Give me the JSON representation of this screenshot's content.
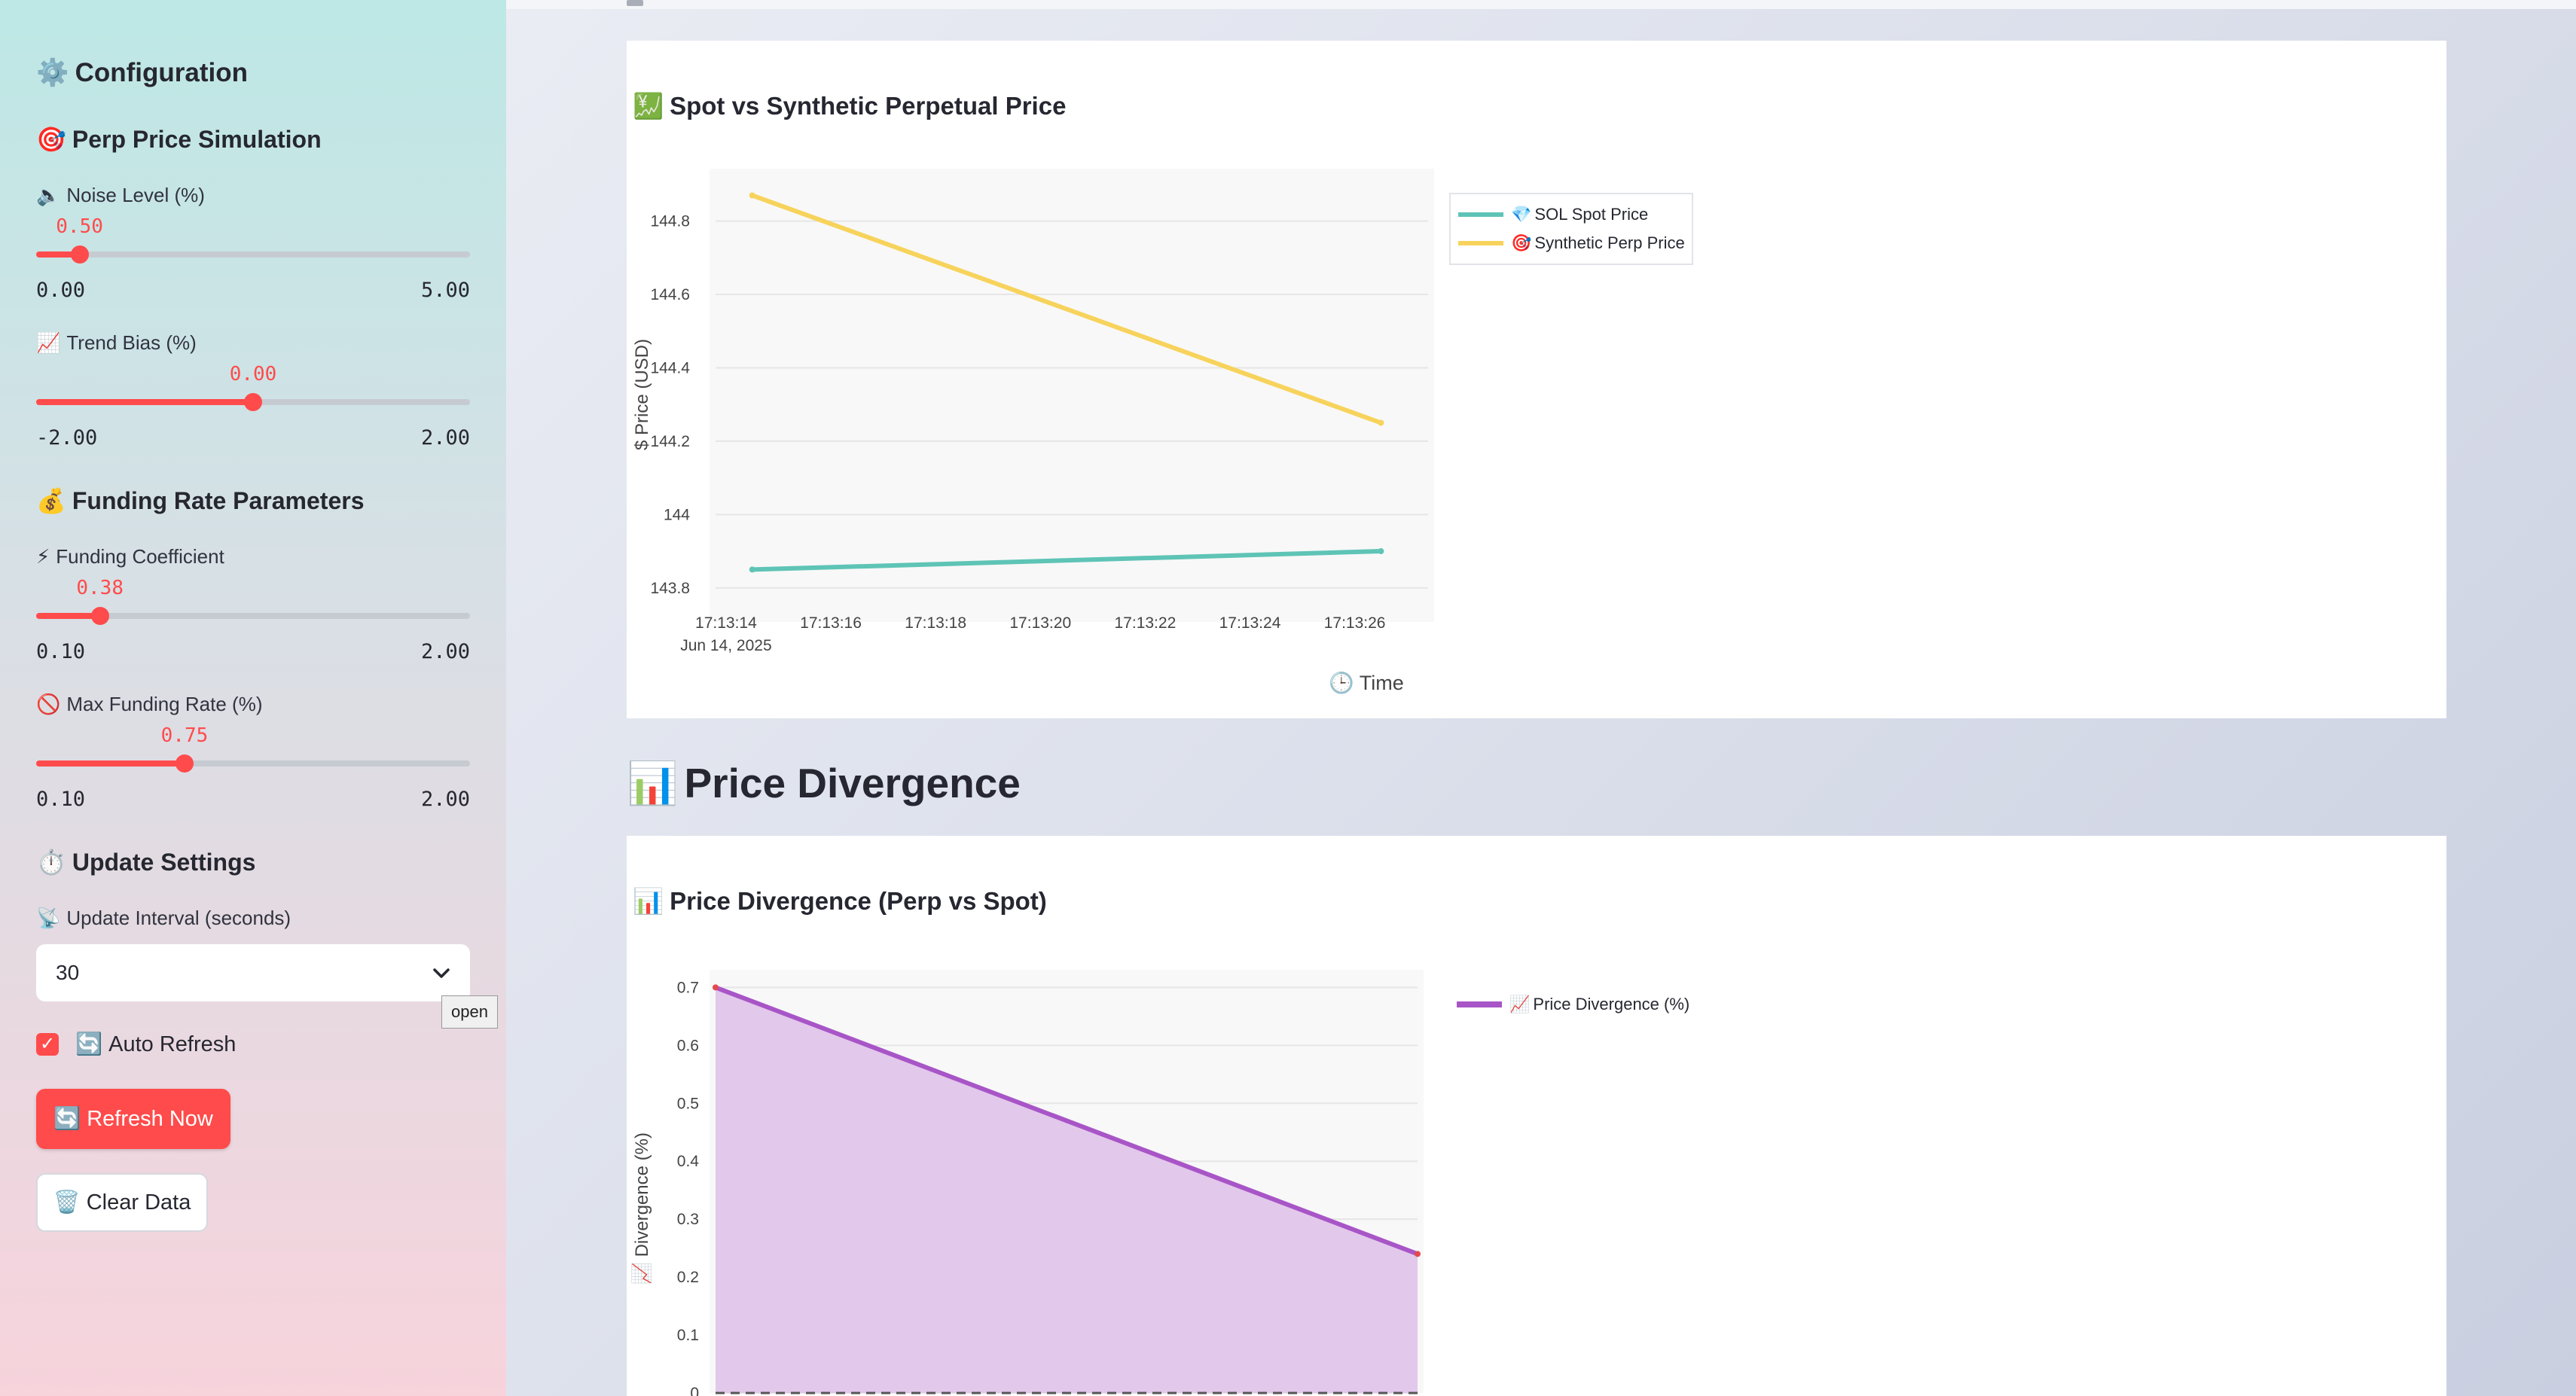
{
  "sidebar": {
    "configuration": "Configuration",
    "configuration_icon": "⚙️",
    "perp_section": "Perp Price Simulation",
    "perp_icon": "🎯",
    "noise": {
      "label": "Noise Level (%)",
      "icon": "🔈",
      "value": "0.50",
      "min": "0.00",
      "max": "5.00",
      "fraction": 0.1
    },
    "trend": {
      "label": "Trend Bias (%)",
      "icon": "📈",
      "value": "0.00",
      "min": "-2.00",
      "max": "2.00",
      "fraction": 0.5
    },
    "funding_section": "Funding Rate Parameters",
    "funding_icon": "💰",
    "coefficient": {
      "label": "Funding Coefficient",
      "icon": "⚡",
      "value": "0.38",
      "min": "0.10",
      "max": "2.00",
      "fraction": 0.147
    },
    "max_funding": {
      "label": "Max Funding Rate (%)",
      "icon": "🚫",
      "value": "0.75",
      "min": "0.10",
      "max": "2.00",
      "fraction": 0.342
    },
    "update_section": "Update Settings",
    "update_icon": "⏱️",
    "interval_label": "Update Interval (seconds)",
    "interval_icon": "📡",
    "interval_value": "30",
    "tooltip": "open",
    "auto_refresh_label": "Auto Refresh",
    "auto_refresh_icon": "🔄",
    "auto_refresh_checked": true,
    "refresh_button": "Refresh Now",
    "refresh_icon": "🔄",
    "clear_button": "Clear Data",
    "clear_icon": "🗑️"
  },
  "main": {
    "price_divergence_heading": "Price Divergence",
    "price_divergence_icon": "📊"
  },
  "colors": {
    "accent": "#ff4b4b",
    "spot": "#5ec4b6",
    "perp": "#f7d35c",
    "divergence": "#a855c7",
    "divergence_fill": "#e2c8eb"
  },
  "chart_data": [
    {
      "type": "line",
      "title": "Spot vs Synthetic Perpetual Price",
      "title_icon": "💹",
      "xlabel": "Time",
      "xlabel_icon": "🕒",
      "ylabel": "$ Price (USD)",
      "x": [
        "17:13:14.5",
        "17:13:26.5"
      ],
      "x_ticks": [
        "17:13:14",
        "17:13:16",
        "17:13:18",
        "17:13:20",
        "17:13:22",
        "17:13:24",
        "17:13:26"
      ],
      "x_tick_sub": "Jun 14, 2025",
      "y_ticks": [
        "143.8",
        "144",
        "144.2",
        "144.4",
        "144.6",
        "144.8"
      ],
      "ylim": [
        143.74,
        144.91
      ],
      "series": [
        {
          "name": "SOL Spot Price",
          "icon": "💎",
          "values": [
            143.85,
            143.9
          ]
        },
        {
          "name": "Synthetic Perp Price",
          "icon": "🎯",
          "values": [
            144.87,
            144.25
          ]
        }
      ],
      "grid": true,
      "legend": "top-right"
    },
    {
      "type": "area",
      "title": "Price Divergence (Perp vs Spot)",
      "title_icon": "📊",
      "ylabel": "Divergence (%)",
      "ylabel_icon": "📈",
      "y_ticks": [
        "0",
        "0.1",
        "0.2",
        "0.3",
        "0.4",
        "0.5",
        "0.6",
        "0.7"
      ],
      "ylim": [
        0,
        0.72
      ],
      "series": [
        {
          "name": "Price Divergence (%)",
          "icon": "📈",
          "values": [
            0.7,
            0.24
          ]
        }
      ],
      "grid": true,
      "legend": "top-right"
    }
  ]
}
